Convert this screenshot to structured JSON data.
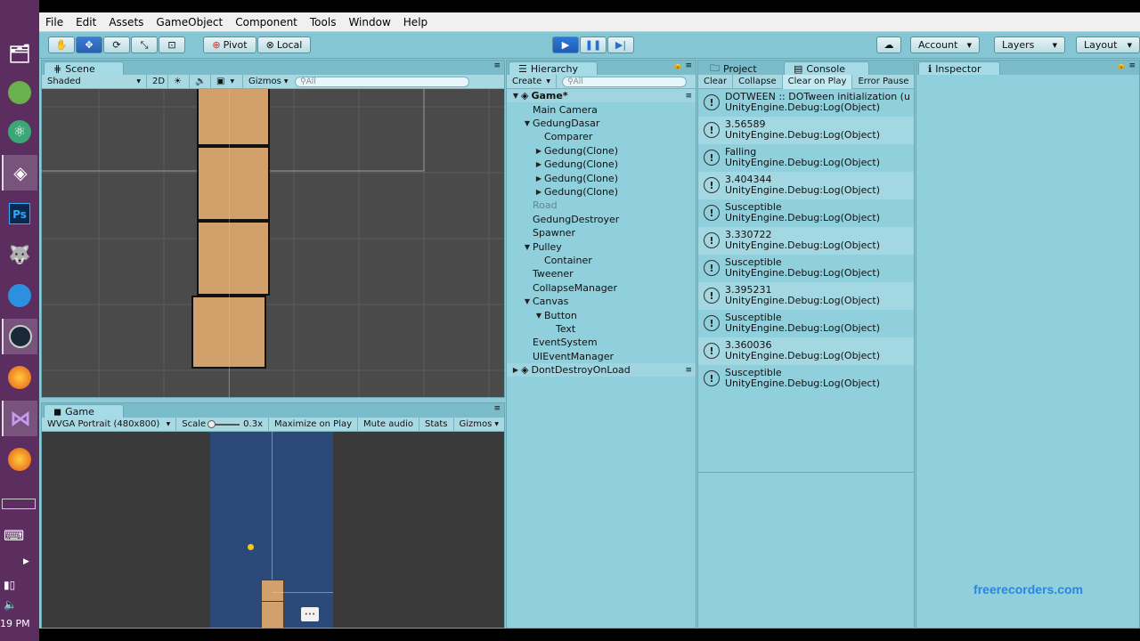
{
  "taskbar": {
    "time": "19 PM",
    "icons": [
      "computer-icon",
      "android-icon",
      "atom-icon",
      "unity-icon",
      "photoshop-icon",
      "game-icon",
      "globe-icon",
      "steam-icon",
      "firefox-icon",
      "visualstudio-icon",
      "firefox-icon-2"
    ]
  },
  "menu": [
    "File",
    "Edit",
    "Assets",
    "GameObject",
    "Component",
    "Tools",
    "Window",
    "Help"
  ],
  "toolbar": {
    "pivot": "Pivot",
    "local": "Local",
    "account": "Account",
    "layers": "Layers",
    "layout": "Layout"
  },
  "scene": {
    "tab": "Scene",
    "shading": "Shaded",
    "mode_2d": "2D",
    "gizmos": "Gizmos",
    "search_placeholder": "All"
  },
  "game": {
    "tab": "Game",
    "resolution": "WVGA Portrait (480x800)",
    "scale_label": "Scale",
    "scale_value": "0.3x",
    "maximize": "Maximize on Play",
    "mute": "Mute audio",
    "stats": "Stats",
    "gizmos": "Gizmos"
  },
  "hierarchy": {
    "tab": "Hierarchy",
    "create": "Create",
    "search_placeholder": "All",
    "items": [
      {
        "label": "Game*",
        "depth": 0,
        "tri": "▼",
        "bold": true,
        "scene": true
      },
      {
        "label": "Main Camera",
        "depth": 1,
        "tri": ""
      },
      {
        "label": "GedungDasar",
        "depth": 1,
        "tri": "▼"
      },
      {
        "label": "Comparer",
        "depth": 2,
        "tri": ""
      },
      {
        "label": "Gedung(Clone)",
        "depth": 2,
        "tri": "▶"
      },
      {
        "label": "Gedung(Clone)",
        "depth": 2,
        "tri": "▶"
      },
      {
        "label": "Gedung(Clone)",
        "depth": 2,
        "tri": "▶"
      },
      {
        "label": "Gedung(Clone)",
        "depth": 2,
        "tri": "▶"
      },
      {
        "label": "Road",
        "depth": 1,
        "tri": "",
        "disabled": true
      },
      {
        "label": "GedungDestroyer",
        "depth": 1,
        "tri": ""
      },
      {
        "label": "Spawner",
        "depth": 1,
        "tri": ""
      },
      {
        "label": "Pulley",
        "depth": 1,
        "tri": "▼"
      },
      {
        "label": "Container",
        "depth": 2,
        "tri": ""
      },
      {
        "label": "Tweener",
        "depth": 1,
        "tri": ""
      },
      {
        "label": "CollapseManager",
        "depth": 1,
        "tri": ""
      },
      {
        "label": "Canvas",
        "depth": 1,
        "tri": "▼"
      },
      {
        "label": "Button",
        "depth": 2,
        "tri": "▼"
      },
      {
        "label": "Text",
        "depth": 3,
        "tri": ""
      },
      {
        "label": "EventSystem",
        "depth": 1,
        "tri": ""
      },
      {
        "label": "UIEventManager",
        "depth": 1,
        "tri": ""
      },
      {
        "label": "DontDestroyOnLoad",
        "depth": 0,
        "tri": "▶",
        "scene": true
      }
    ]
  },
  "console": {
    "tab_project": "Project",
    "tab_console": "Console",
    "buttons": [
      "Clear",
      "Collapse",
      "Clear on Play",
      "Error Pause"
    ],
    "entries": [
      {
        "line1": "DOTWEEN :: DOTween initialization (u",
        "line2": "UnityEngine.Debug:Log(Object)"
      },
      {
        "line1": "3.56589",
        "line2": "UnityEngine.Debug:Log(Object)"
      },
      {
        "line1": "Falling",
        "line2": "UnityEngine.Debug:Log(Object)"
      },
      {
        "line1": "3.404344",
        "line2": "UnityEngine.Debug:Log(Object)"
      },
      {
        "line1": "Susceptible",
        "line2": "UnityEngine.Debug:Log(Object)"
      },
      {
        "line1": "3.330722",
        "line2": "UnityEngine.Debug:Log(Object)"
      },
      {
        "line1": "Susceptible",
        "line2": "UnityEngine.Debug:Log(Object)"
      },
      {
        "line1": "3.395231",
        "line2": "UnityEngine.Debug:Log(Object)"
      },
      {
        "line1": "Susceptible",
        "line2": "UnityEngine.Debug:Log(Object)"
      },
      {
        "line1": "3.360036",
        "line2": "UnityEngine.Debug:Log(Object)"
      },
      {
        "line1": "Susceptible",
        "line2": "UnityEngine.Debug:Log(Object)"
      }
    ]
  },
  "inspector": {
    "tab": "Inspector"
  },
  "watermark": "freerecorders.com"
}
